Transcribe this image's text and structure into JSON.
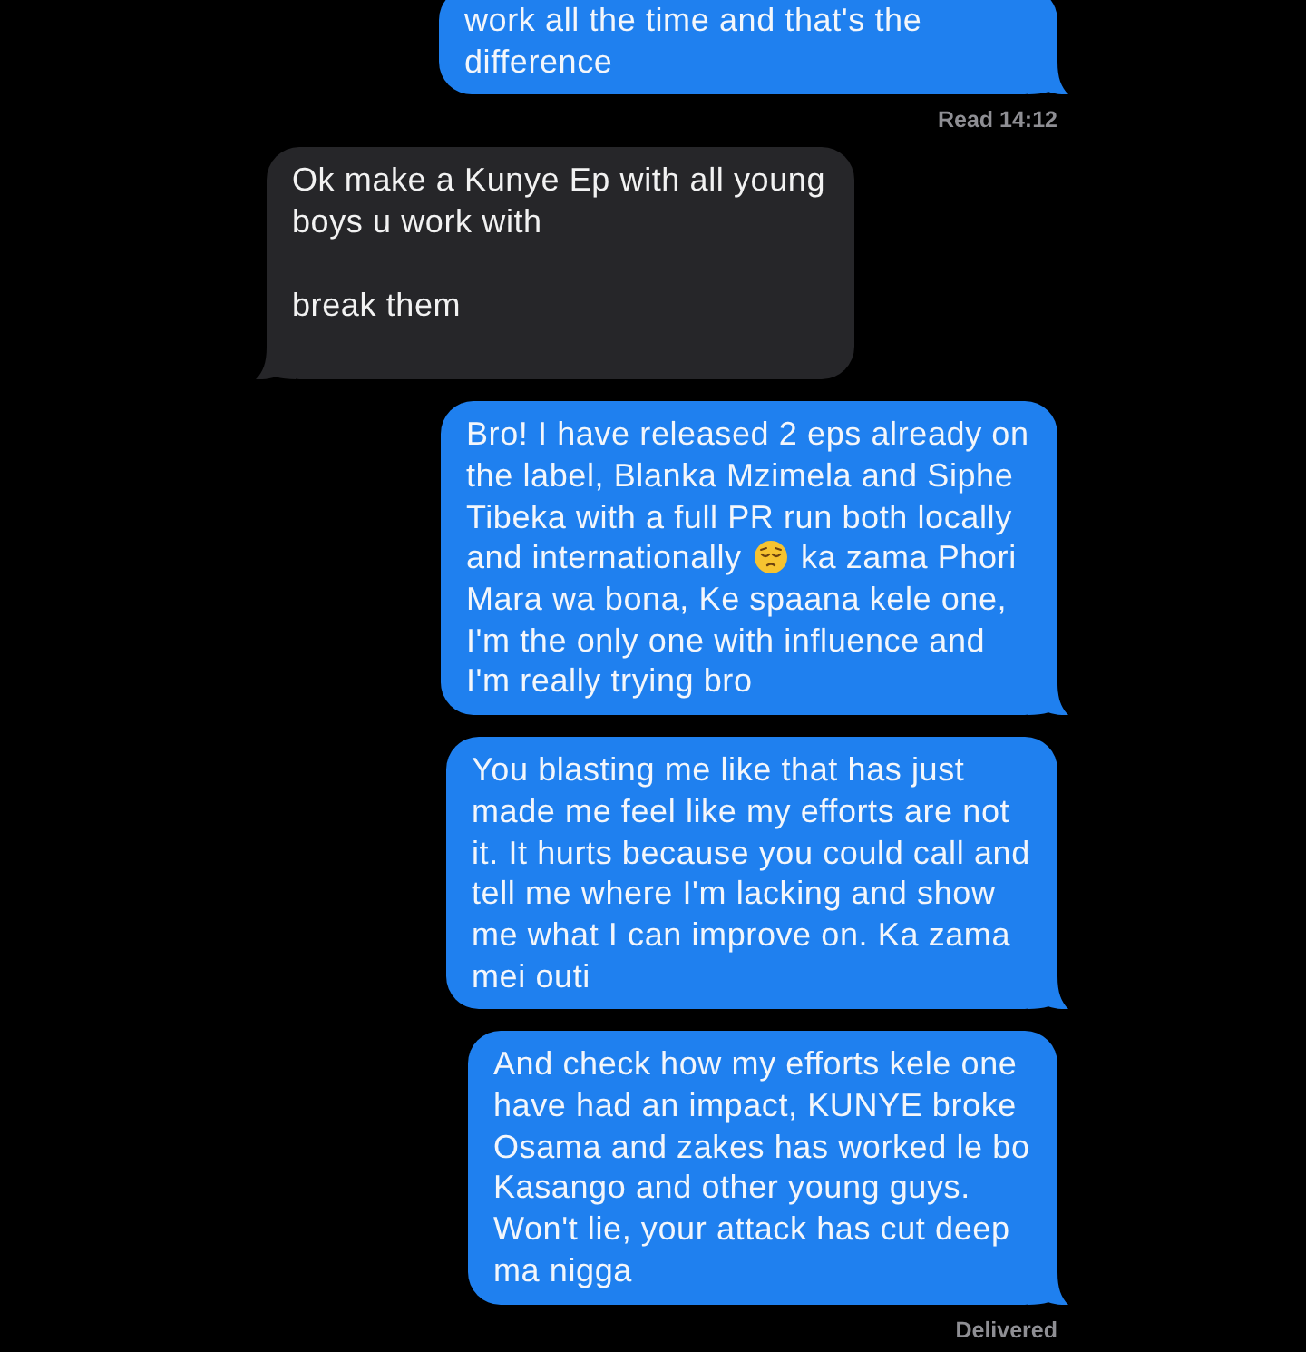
{
  "messages": [
    {
      "kind": "sent",
      "clipped": true,
      "parts": [
        {
          "kind": "text",
          "text": "work all the time and that's the difference"
        }
      ],
      "status": "Read 14:12"
    },
    {
      "kind": "received",
      "clipped": false,
      "parts": [
        {
          "kind": "text",
          "text": "Ok make a Kunye Ep with all young boys u work with\n\nbreak them"
        }
      ]
    },
    {
      "kind": "sent",
      "clipped": false,
      "parts": [
        {
          "kind": "text",
          "text": "Bro! I have released 2 eps already on the label, Blanka Mzimela and Siphe Tibeka with a full PR run both locally and internationally"
        },
        {
          "kind": "emoji"
        },
        {
          "kind": "text",
          "text": "ka zama Phori Mara wa bona, Ke spaana kele one, I'm the only one with influence and I'm really trying bro"
        }
      ]
    },
    {
      "kind": "sent",
      "clipped": false,
      "parts": [
        {
          "kind": "text",
          "text": "You blasting me like that has just made me feel like my efforts are not it. It hurts because you could call and tell me where I'm lacking and show me what I can improve on. Ka zama mei outi"
        }
      ]
    },
    {
      "kind": "sent",
      "clipped": false,
      "parts": [
        {
          "kind": "text",
          "text": "And check how my efforts kele one have had an impact, KUNYE broke Osama and zakes has worked le bo Kasango and other young guys. Won't lie, your attack has cut deep ma nigga"
        }
      ],
      "status": "Delivered"
    }
  ]
}
